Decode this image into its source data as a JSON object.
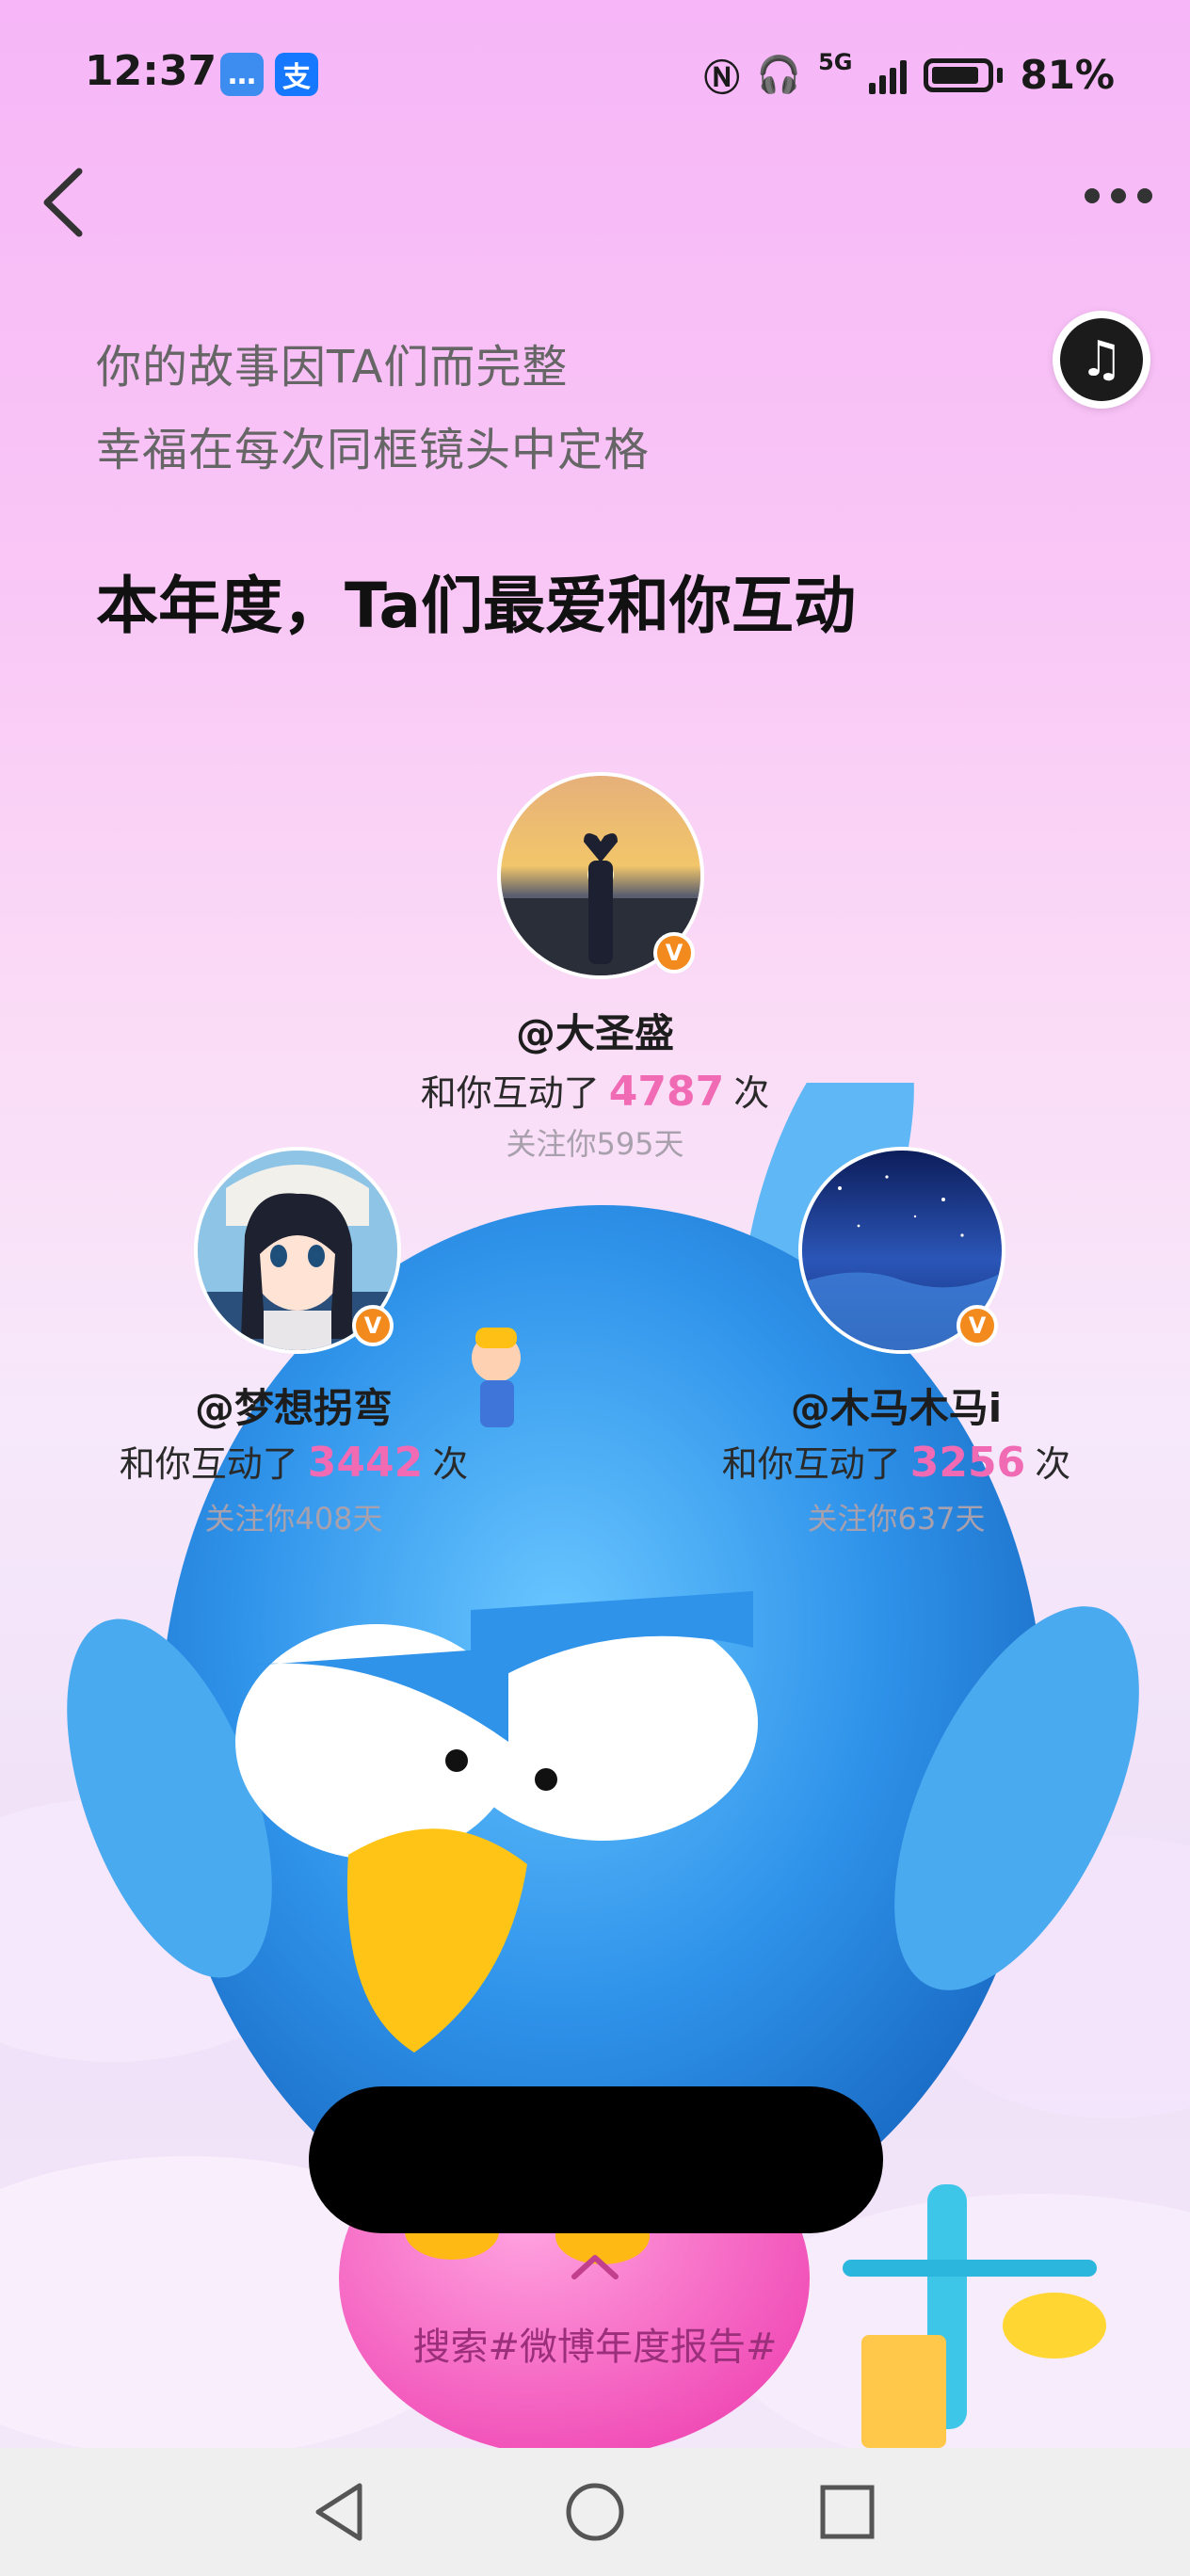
{
  "status_bar": {
    "time": "12:37",
    "app_icons": [
      {
        "name": "message-bubble-icon",
        "glyph": "…",
        "color": "#3d8cf0"
      },
      {
        "name": "alipay-icon",
        "glyph": "支",
        "color": "#1677ff"
      }
    ],
    "battery": "81%",
    "network": "5G"
  },
  "header": {
    "back_icon": "chevron-left-icon",
    "more_icon": "more-dots-icon"
  },
  "music_icon": "♫",
  "intro": {
    "line1": "你的故事因TA们而完整",
    "line2": "幸福在每次同框镜头中定格"
  },
  "headline": "本年度，Ta们最爱和你互动",
  "users": [
    {
      "name": "@大圣盛",
      "count_prefix": "和你互动了",
      "count": "4787",
      "count_suffix": "次",
      "follow": "关注你595天"
    },
    {
      "name": "@梦想拐弯",
      "count_prefix": "和你互动了",
      "count": "3442",
      "count_suffix": "次",
      "follow": "关注你408天"
    },
    {
      "name": "@木马木马i",
      "count_prefix": "和你互动了",
      "count": "3256",
      "count_suffix": "次",
      "follow": "关注你637天"
    }
  ],
  "verified_badge": "V",
  "search_hint": "搜索#微博年度报告#",
  "colors": {
    "accent": "#f06ab4",
    "badge": "#f28a1d",
    "mascot": "#3aa3f2"
  }
}
